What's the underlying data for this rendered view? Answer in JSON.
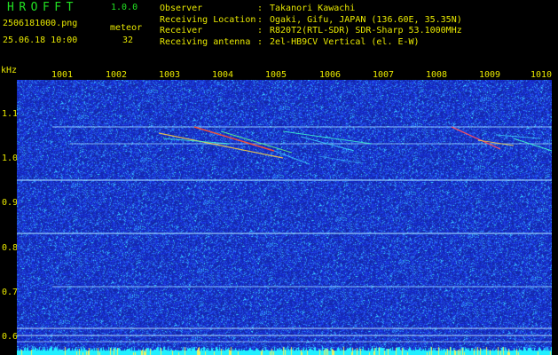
{
  "header": {
    "app_title": "HROFFT",
    "app_version": "1.0.0",
    "filename": "2506181000.png",
    "datetime": "25.06.18 10:00",
    "meteor_label": "meteor",
    "meteor_count": "32"
  },
  "info": {
    "rows": [
      {
        "key": "Observer",
        "sep": ":",
        "value": "Takanori Kawachi"
      },
      {
        "key": "Receiving Location",
        "sep": ":",
        "value": "Ogaki, Gifu, JAPAN (136.60E, 35.35N)"
      },
      {
        "key": "Receiver",
        "sep": ":",
        "value": "R820T2(RTL-SDR) SDR-Sharp 53.1000MHz"
      },
      {
        "key": "Receiving antenna",
        "sep": ":",
        "value": "2el-HB9CV Vertical (el. E-W)"
      }
    ]
  },
  "spectrogram": {
    "y_unit_label": "kHz",
    "y_ticks": [
      "1.1",
      "1.0",
      "0.9",
      "0.8",
      "0.7",
      "0.6"
    ],
    "x_ticks": [
      "1001",
      "1002",
      "1003",
      "1004",
      "1005",
      "1006",
      "1007",
      "1008",
      "1009",
      "1010"
    ],
    "colors": {
      "background": "#1a2ea0",
      "carrier": "#9fd8ff",
      "text": "#e8e800",
      "title": "#22e022",
      "noise_bar": "#21f0ff"
    }
  }
}
